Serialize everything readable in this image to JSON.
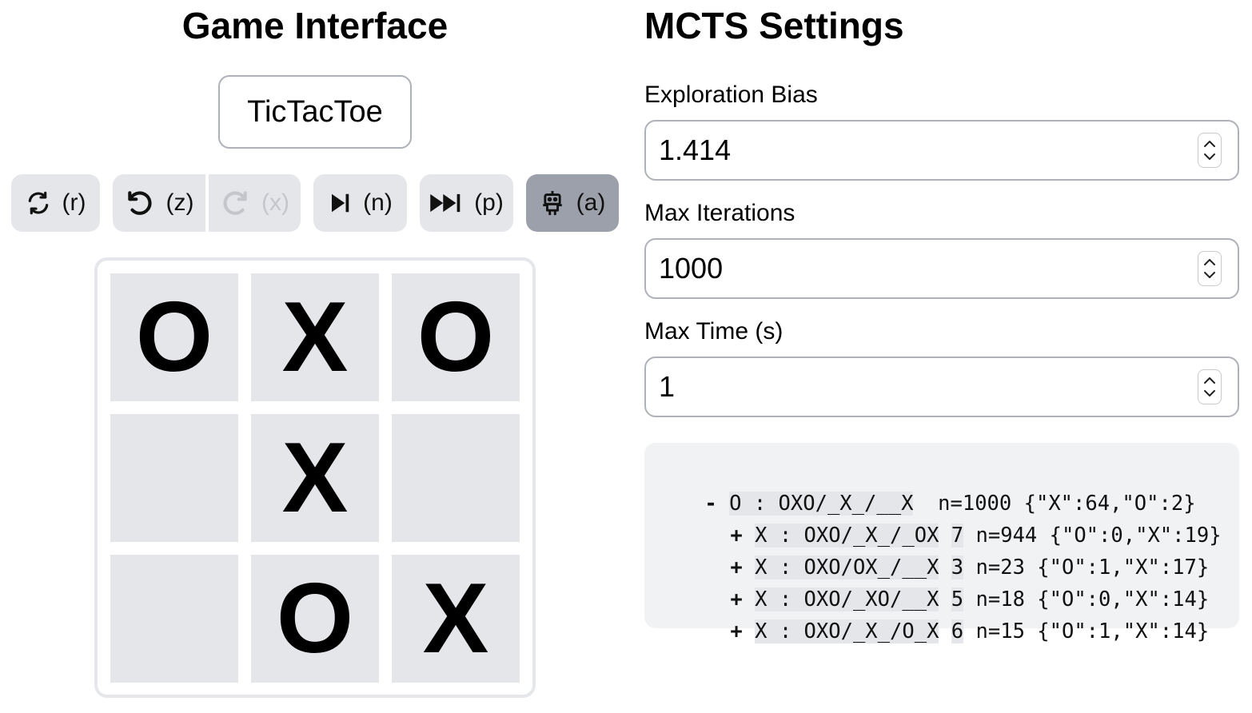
{
  "left_panel": {
    "title": "Game Interface",
    "game_select": {
      "value": "TicTacToe"
    },
    "toolbar": {
      "reset": {
        "icon": "reset-icon",
        "key": "(r)"
      },
      "undo": {
        "icon": "undo-icon",
        "key": "(z)"
      },
      "redo": {
        "icon": "redo-icon",
        "key": "(x)",
        "disabled": true
      },
      "next": {
        "icon": "step-forward-icon",
        "key": "(n)"
      },
      "play": {
        "icon": "fast-forward-icon",
        "key": "(p)"
      },
      "auto": {
        "icon": "robot-icon",
        "key": "(a)",
        "active": true
      }
    },
    "board": {
      "cells": [
        "O",
        "X",
        "O",
        "",
        "X",
        "",
        "",
        "O",
        "X"
      ]
    }
  },
  "right_panel": {
    "title": "MCTS Settings",
    "exploration_bias": {
      "label": "Exploration Bias",
      "value": "1.414"
    },
    "max_iterations": {
      "label": "Max Iterations",
      "value": "1000"
    },
    "max_time": {
      "label": "Max Time (s)",
      "value": "1"
    },
    "tree": {
      "root": {
        "sign": "-",
        "node": "O : OXO/_X_/__X",
        "stats": " n=1000 {\"X\":64,\"O\":2}"
      },
      "children": [
        {
          "sign": "+",
          "node": "X : OXO/_X_/_OX",
          "move": "7",
          "stats": "n=944 {\"O\":0,\"X\":19}"
        },
        {
          "sign": "+",
          "node": "X : OXO/OX_/__X",
          "move": "3",
          "stats": "n=23 {\"O\":1,\"X\":17}"
        },
        {
          "sign": "+",
          "node": "X : OXO/_XO/__X",
          "move": "5",
          "stats": "n=18 {\"O\":0,\"X\":14}"
        },
        {
          "sign": "+",
          "node": "X : OXO/_X_/O_X",
          "move": "6",
          "stats": "n=15 {\"O\":1,\"X\":14}"
        }
      ]
    }
  },
  "colors": {
    "button_bg": "#e5e6e9",
    "button_active_bg": "#9ca0aa",
    "button_disabled_fg": "#c4c6cb",
    "cell_bg": "#e5e6e9",
    "tree_bg": "#f1f2f4",
    "input_border": "#aeb1b8"
  }
}
